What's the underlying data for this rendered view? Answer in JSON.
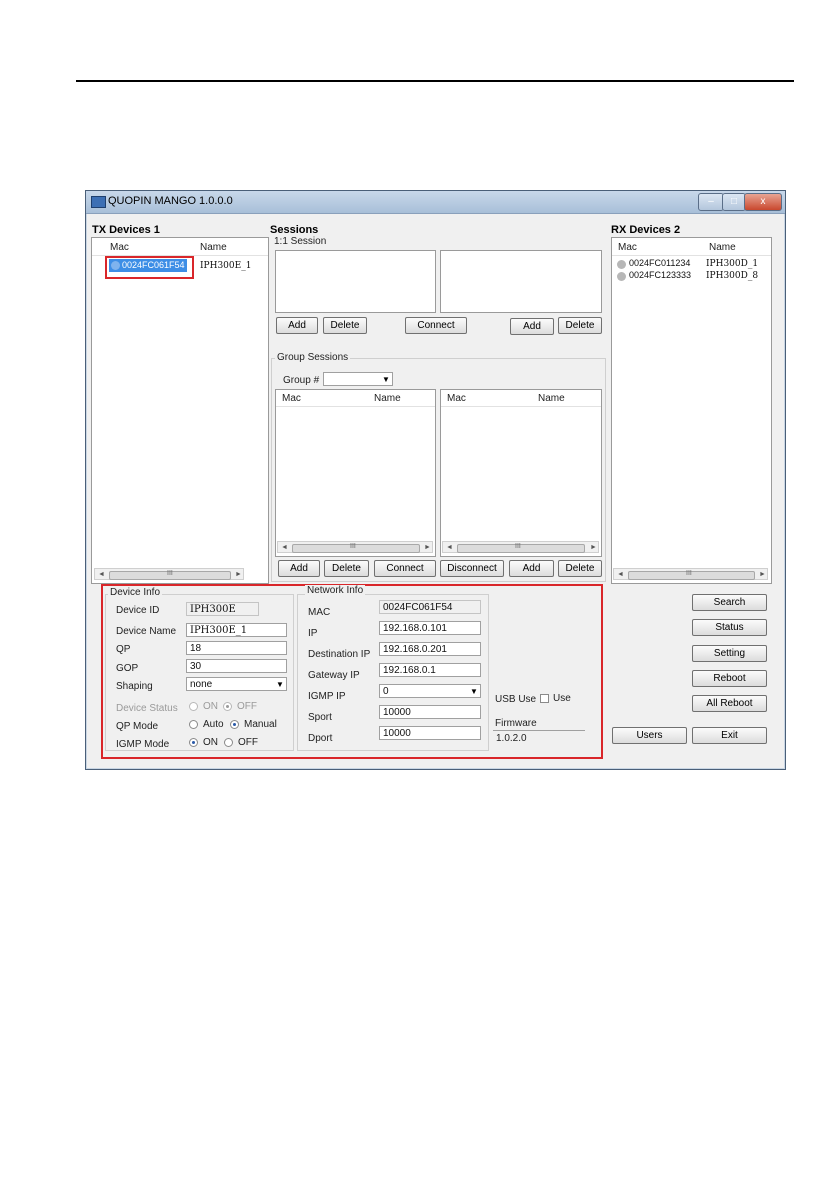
{
  "window": {
    "title": "QUOPIN MANGO 1.0.0.0",
    "minimize": "–",
    "maximize": "□",
    "close": "x"
  },
  "tx": {
    "title": "TX Devices 1",
    "col_mac": "Mac",
    "col_name": "Name",
    "rows": [
      {
        "mac": "0024FC061F54",
        "name": "IPH300E_1",
        "selected": true
      }
    ],
    "scroll_mark": "III"
  },
  "sessions": {
    "title": "Sessions",
    "one_to_one": {
      "label": "1:1 Session",
      "add": "Add",
      "delete": "Delete",
      "connect": "Connect",
      "add2": "Add",
      "delete2": "Delete"
    },
    "group": {
      "label": "Group Sessions",
      "group_label": "Group #",
      "group_value": "",
      "col_mac": "Mac",
      "col_name": "Name",
      "col_mac2": "Mac",
      "col_name2": "Name",
      "add": "Add",
      "delete": "Delete",
      "connect": "Connect",
      "disconnect": "Disconnect",
      "add2": "Add",
      "delete2": "Delete",
      "scroll_mark": "III"
    }
  },
  "rx": {
    "title": "RX Devices 2",
    "col_mac": "Mac",
    "col_name": "Name",
    "rows": [
      {
        "mac": "0024FC011234",
        "name": "IPH300D_1"
      },
      {
        "mac": "0024FC123333",
        "name": "IPH300D_8"
      }
    ],
    "scroll_mark": "III"
  },
  "device_info": {
    "label": "Device Info",
    "device_id_label": "Device ID",
    "device_id": "IPH300E",
    "device_name_label": "Device Name",
    "device_name": "IPH300E_1",
    "qp_label": "QP",
    "qp": "18",
    "gop_label": "GOP",
    "gop": "30",
    "shaping_label": "Shaping",
    "shaping": "none",
    "status_label": "Device Status",
    "status_on": "ON",
    "status_off": "OFF",
    "qp_mode_label": "QP Mode",
    "qp_mode_auto": "Auto",
    "qp_mode_manual": "Manual",
    "igmp_mode_label": "IGMP Mode",
    "igmp_on": "ON",
    "igmp_off": "OFF"
  },
  "network_info": {
    "label": "Network Info",
    "mac_label": "MAC",
    "mac": "0024FC061F54",
    "ip_label": "IP",
    "ip": "192.168.0.101",
    "dest_ip_label": "Destination IP",
    "dest_ip": "192.168.0.201",
    "gateway_ip_label": "Gateway IP",
    "gateway_ip": "192.168.0.1",
    "igmp_ip_label": "IGMP IP",
    "igmp_ip": "0",
    "sport_label": "Sport",
    "sport": "10000",
    "dport_label": "Dport",
    "dport": "10000"
  },
  "usb": {
    "label": "USB Use",
    "check_label": "Use"
  },
  "firmware": {
    "label": "Firmware",
    "value": "1.0.2.0"
  },
  "actions": {
    "search": "Search",
    "status": "Status",
    "setting": "Setting",
    "reboot": "Reboot",
    "all_reboot": "All Reboot",
    "users": "Users",
    "exit": "Exit"
  }
}
